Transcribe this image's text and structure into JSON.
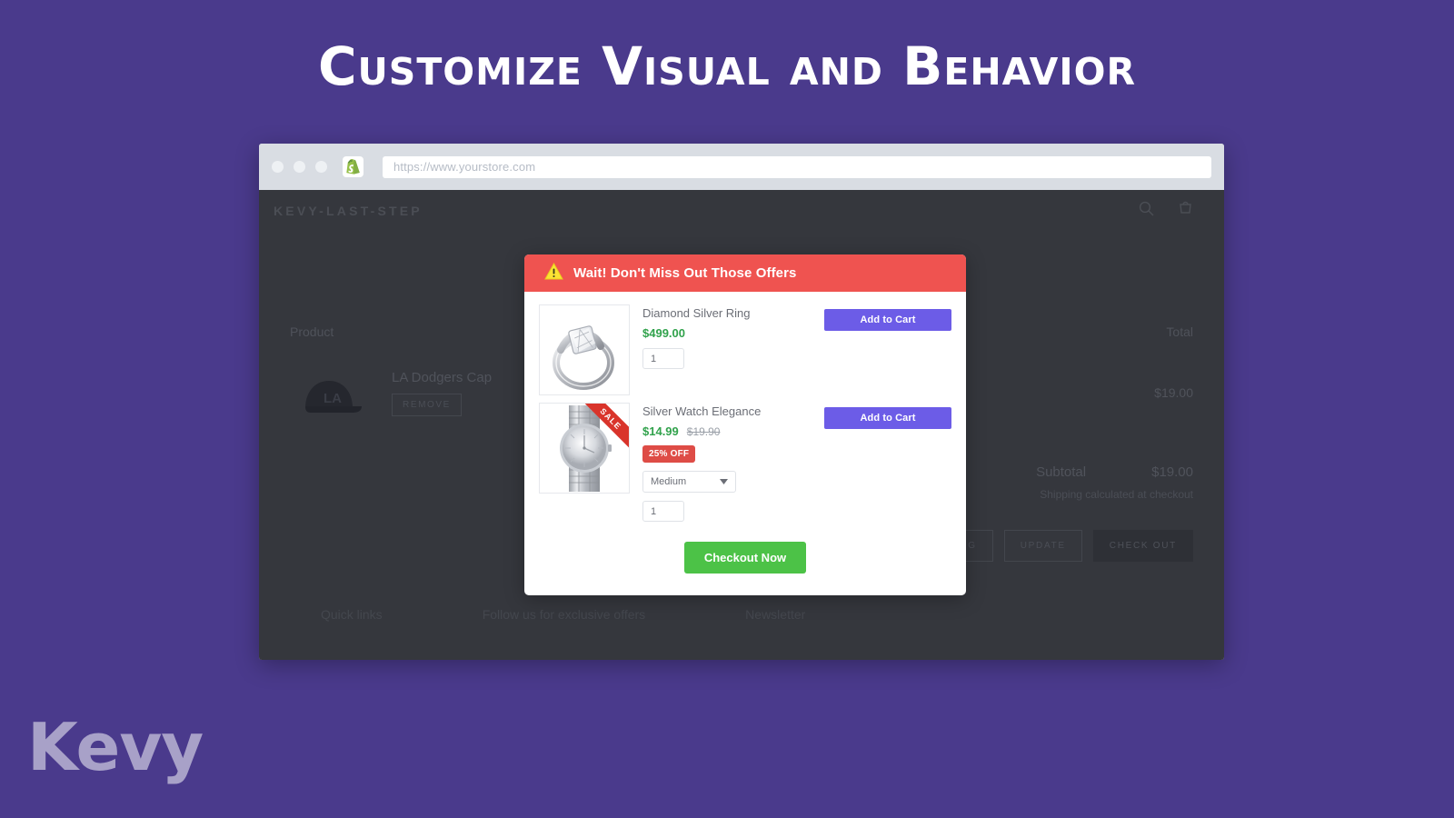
{
  "hero": {
    "title": "Customize Visual and Behavior"
  },
  "theme": {
    "background": "#4a3a8c",
    "accent_purple": "#6c5ce7",
    "alert_red": "#ef5350",
    "badge_red": "#de4c46",
    "success_green": "#4cc247",
    "price_green": "#31a24c"
  },
  "browser": {
    "url_value": "https://www.yourstore.com",
    "url_placeholder": "https://www.yourstore.com",
    "shopify_icon": "shopify-logo-icon",
    "traffic_lights": [
      "window-close-dot",
      "window-minimize-dot",
      "window-maximize-dot"
    ]
  },
  "store": {
    "name": "KEVY-LAST-STEP",
    "header_icons": [
      "search-icon",
      "cart-icon"
    ],
    "cart": {
      "col_product": "Product",
      "col_total": "Total",
      "items": [
        {
          "title": "LA Dodgers Cap",
          "remove_label": "REMOVE",
          "total": "$19.00",
          "thumb": "baseball-cap-image"
        }
      ],
      "subtotal_label": "Subtotal",
      "subtotal_value": "$19.00",
      "shipping_note": "Shipping calculated at checkout",
      "actions": [
        {
          "label": "CONTINUE SHOPPING",
          "style": "outline"
        },
        {
          "label": "UPDATE",
          "style": "outline"
        },
        {
          "label": "CHECK OUT",
          "style": "solid"
        }
      ]
    },
    "footer": {
      "columns": [
        "Quick links",
        "Follow us for exclusive offers",
        "Newsletter"
      ]
    }
  },
  "modal": {
    "warning_icon": "warning-triangle-icon",
    "title": "Wait! Don't Miss Out Those Offers",
    "offers": [
      {
        "image": "diamond-silver-ring-image",
        "title": "Diamond Silver Ring",
        "price": "$499.00",
        "compare_at_price": null,
        "discount_badge": null,
        "sale_ribbon": null,
        "variant": null,
        "quantity": "1",
        "add_to_cart_label": "Add to Cart"
      },
      {
        "image": "silver-watch-image",
        "title": "Silver Watch Elegance",
        "price": "$14.99",
        "compare_at_price": "$19.90",
        "discount_badge": "25% OFF",
        "sale_ribbon": "SALE",
        "variant": "Medium",
        "quantity": "1",
        "add_to_cart_label": "Add to Cart"
      }
    ],
    "checkout_label": "Checkout Now"
  },
  "brand": {
    "logo_text": "Kevy",
    "logo_mark": "kevy-k-mark-icon"
  }
}
